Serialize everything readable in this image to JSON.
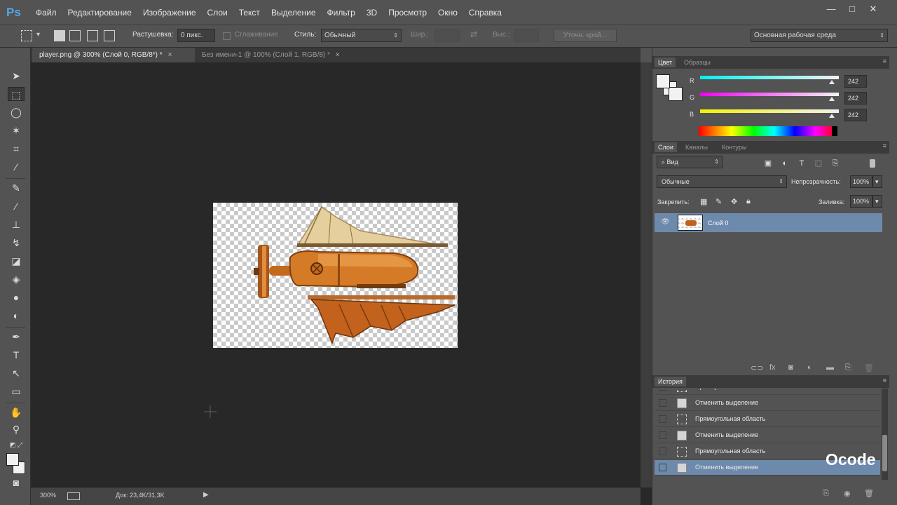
{
  "app": {
    "logo": "Ps",
    "watermark": "Ocode"
  },
  "menu": [
    "Файл",
    "Редактирование",
    "Изображение",
    "Слои",
    "Текст",
    "Выделение",
    "Фильтр",
    "3D",
    "Просмотр",
    "Окно",
    "Справка"
  ],
  "window_controls": [
    "—",
    "□",
    "✕"
  ],
  "options": {
    "feather_label": "Растушевка:",
    "feather_value": "0 пикс.",
    "antialias_label": "Сглаживание",
    "style_label": "Стиль:",
    "style_value": "Обычный",
    "width_label": "Шир.:",
    "height_label": "Выс.:",
    "refine_button": "Уточн. край...",
    "workspace_value": "Основная рабочая среда"
  },
  "tabs": [
    {
      "label": "player.png @ 300% (Слой 0, RGB/8*) *",
      "active": true
    },
    {
      "label": "Без имени-1 @ 100% (Слой 1, RGB/8) *",
      "active": false
    }
  ],
  "status": {
    "zoom": "300%",
    "doc": "Док: 23,4K/31,3K"
  },
  "color_panel": {
    "tabs": [
      "Цвет",
      "Образцы"
    ],
    "r": "242",
    "g": "242",
    "b": "242",
    "r_label": "R",
    "g_label": "G",
    "b_label": "B",
    "fg_color": "#f2f2f2"
  },
  "layers_panel": {
    "tabs": [
      "Слои",
      "Каналы",
      "Контуры"
    ],
    "filter_value": "Вид",
    "blend_mode": "Обычные",
    "opacity_label": "Непрозрачность:",
    "opacity_value": "100%",
    "lock_label": "Закрепить:",
    "fill_label": "Заливка:",
    "fill_value": "100%",
    "layers": [
      {
        "name": "Слой 0",
        "visible": true,
        "selected": true
      }
    ]
  },
  "history_panel": {
    "title": "История",
    "items": [
      {
        "label": "Прямоугольная область",
        "icon": "marquee",
        "selected": false,
        "partial": true
      },
      {
        "label": "Отменить выделение",
        "icon": "doc",
        "selected": false
      },
      {
        "label": "Прямоугольная область",
        "icon": "marquee",
        "selected": false
      },
      {
        "label": "Отменить выделение",
        "icon": "doc",
        "selected": false
      },
      {
        "label": "Прямоугольная область",
        "icon": "marquee",
        "selected": false
      },
      {
        "label": "Отменить выделение",
        "icon": "doc",
        "selected": true
      }
    ]
  },
  "colors": {
    "ui_dark": "#282828",
    "ui_panel": "#535353",
    "selection": "#6d8aac",
    "accent": "#54a7e8"
  }
}
